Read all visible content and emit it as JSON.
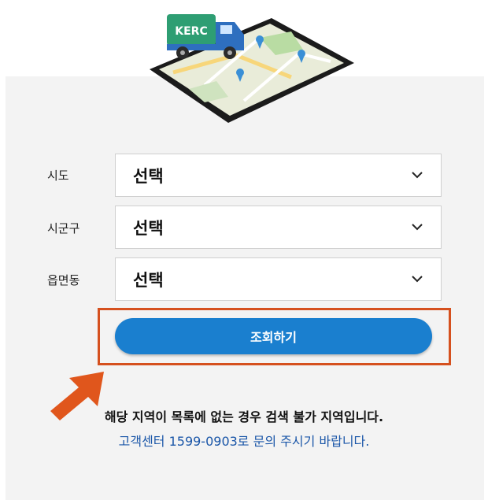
{
  "illustration": {
    "truck_label": "KERC"
  },
  "form": {
    "rows": [
      {
        "label": "시도",
        "value": "선택"
      },
      {
        "label": "시군구",
        "value": "선택"
      },
      {
        "label": "읍면동",
        "value": "선택"
      }
    ],
    "search_button": "조회하기"
  },
  "notice": {
    "line1": "해당 지역이 목록에 없는 경우 검색 불가 지역입니다.",
    "line2": "고객센터 1599-0903로 문의 주시기 바랍니다."
  },
  "colors": {
    "button": "#1a7fcf",
    "highlight": "#d5501e",
    "truck": "#2e9e73",
    "notice_link": "#1a56a8"
  },
  "icons": {
    "select_toggle": "chevron-down-icon",
    "pointer": "arrow-icon"
  }
}
